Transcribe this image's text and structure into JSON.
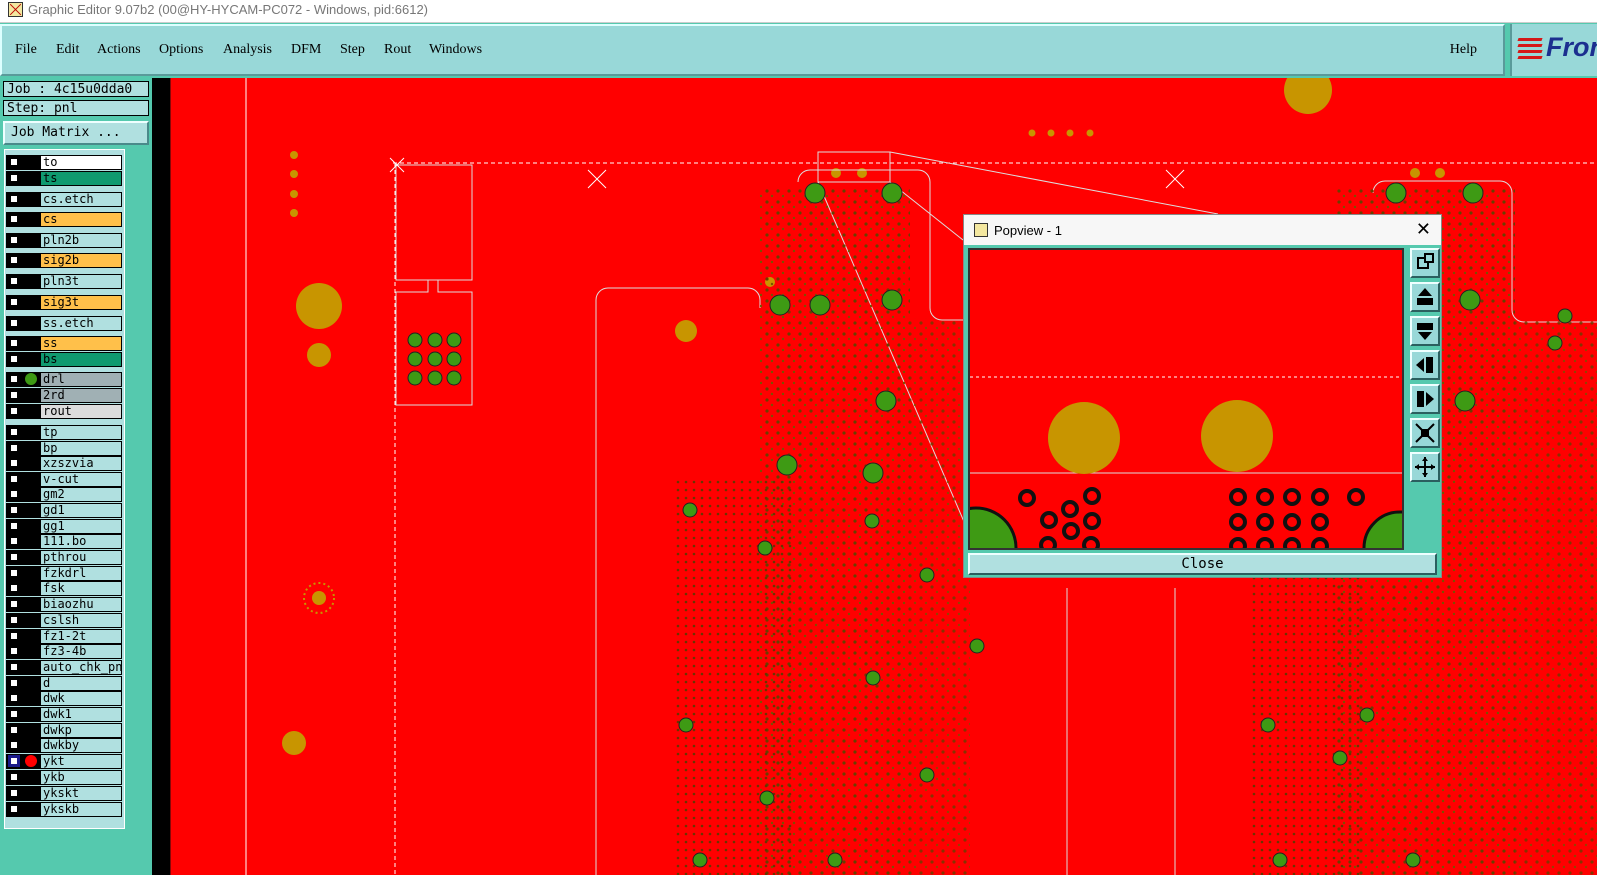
{
  "window": {
    "title": "Graphic Editor 9.07b2 (00@HY-HYCAM-PC072 - Windows, pid:6612)"
  },
  "menubar": {
    "items": [
      {
        "label": "File"
      },
      {
        "label": "Edit"
      },
      {
        "label": "Actions"
      },
      {
        "label": "Options"
      },
      {
        "label": "Analysis"
      },
      {
        "label": "DFM"
      },
      {
        "label": "Step"
      },
      {
        "label": "Rout"
      },
      {
        "label": "Windows"
      }
    ],
    "help_label": "Help",
    "logo_text": "Fron"
  },
  "sidebar": {
    "job": "Job : 4c15u0dda0",
    "step": "Step: pnl",
    "job_matrix_label": "Job Matrix ...",
    "layers": [
      {
        "name": "to",
        "color": "#ffffff"
      },
      {
        "name": "ts",
        "color": "#0f9a6f"
      },
      {
        "name": "cs.etch",
        "color": "#b0e0e0"
      },
      {
        "name": "cs",
        "color": "#ffc04a"
      },
      {
        "name": "pln2b",
        "color": "#b0e0e0"
      },
      {
        "name": "sig2b",
        "color": "#ffc04a"
      },
      {
        "name": "pln3t",
        "color": "#b0e0e0"
      },
      {
        "name": "sig3t",
        "color": "#ffc04a"
      },
      {
        "name": "ss.etch",
        "color": "#b0e0e0"
      },
      {
        "name": "ss",
        "color": "#ffc04a"
      },
      {
        "name": "bs",
        "color": "#0f9a6f"
      },
      {
        "name": "drl",
        "color": "#a0b0b4",
        "dot": "#3e9a14"
      },
      {
        "name": "2rd",
        "color": "#a0b0b4"
      },
      {
        "name": "rout",
        "color": "#dcdcdc"
      },
      {
        "name": "tp",
        "color": "#b0e0e0"
      },
      {
        "name": "bp",
        "color": "#b0e0e0"
      },
      {
        "name": "xzszvia",
        "color": "#b0e0e0"
      },
      {
        "name": "v-cut",
        "color": "#b0e0e0"
      },
      {
        "name": "gm2",
        "color": "#b0e0e0"
      },
      {
        "name": "gd1",
        "color": "#b0e0e0"
      },
      {
        "name": "gg1",
        "color": "#b0e0e0"
      },
      {
        "name": "111.bo",
        "color": "#b0e0e0"
      },
      {
        "name": "pthrou",
        "color": "#b0e0e0"
      },
      {
        "name": "fzkdrl",
        "color": "#b0e0e0"
      },
      {
        "name": "fsk",
        "color": "#b0e0e0"
      },
      {
        "name": "biaozhu",
        "color": "#b0e0e0"
      },
      {
        "name": "cslsh",
        "color": "#b0e0e0"
      },
      {
        "name": "fz1-2t",
        "color": "#b0e0e0"
      },
      {
        "name": "fz3-4b",
        "color": "#b0e0e0"
      },
      {
        "name": "auto_chk_pnl",
        "color": "#b0e0e0"
      },
      {
        "name": "d",
        "color": "#b0e0e0"
      },
      {
        "name": "dwk",
        "color": "#b0e0e0"
      },
      {
        "name": "dwk1",
        "color": "#b0e0e0"
      },
      {
        "name": "dwkp",
        "color": "#b0e0e0"
      },
      {
        "name": "dwkby",
        "color": "#b0e0e0"
      },
      {
        "name": "ykt",
        "color": "#b0e0e0",
        "dot": "#ff0000",
        "active": true
      },
      {
        "name": "ykb",
        "color": "#b0e0e0"
      },
      {
        "name": "ykskt",
        "color": "#b0e0e0"
      },
      {
        "name": "ykskb",
        "color": "#b0e0e0"
      }
    ]
  },
  "popview": {
    "title": "Popview - 1",
    "close_label": "Close",
    "tools": [
      "zoom-fit-icon",
      "pan-up-icon",
      "pan-down-icon",
      "pan-left-icon",
      "pan-right-icon",
      "zoom-out-icon",
      "zoom-in-icon"
    ]
  },
  "colors": {
    "board": "#ff0000",
    "pad_gold": "#c89500",
    "pad_green": "#3e9a14",
    "panel_bg": "#98d8d8"
  }
}
